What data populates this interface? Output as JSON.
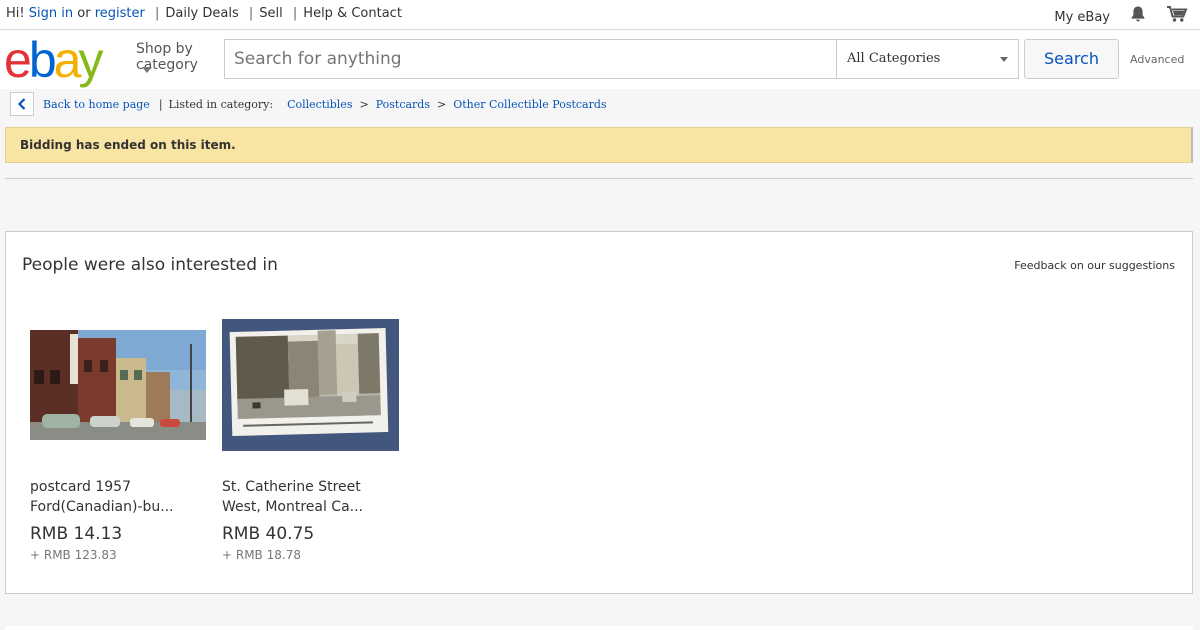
{
  "topbar": {
    "greeting": "Hi!",
    "signin": "Sign in",
    "or": "or",
    "register": "register",
    "daily_deals": "Daily Deals",
    "sell": "Sell",
    "help": "Help & Contact",
    "my_ebay": "My eBay",
    "icons": [
      "bell-icon",
      "cart-icon"
    ]
  },
  "header": {
    "logo": {
      "e": "e",
      "b": "b",
      "a": "a",
      "y": "y"
    },
    "shop_by_line1": "Shop by",
    "shop_by_line2": "category",
    "search_placeholder": "Search for anything",
    "category_selected": "All Categories",
    "search_button": "Search",
    "advanced": "Advanced"
  },
  "breadcrumb": {
    "back": "Back to home page",
    "listed": "Listed in category:",
    "items": [
      "Collectibles",
      "Postcards",
      "Other Collectible Postcards"
    ],
    "separator": ">"
  },
  "banner": {
    "message": "Bidding has ended on this item."
  },
  "suggestions": {
    "title": "People were also interested in",
    "feedback": "Feedback on our suggestions",
    "items": [
      {
        "title_line1": "postcard 1957",
        "title_line2": "Ford(Canadian)-bu...",
        "price": "RMB 14.13",
        "shipping": "+ RMB 123.83"
      },
      {
        "title_line1": "St. Catherine Street",
        "title_line2": "West, Montreal Ca...",
        "price": "RMB 40.75",
        "shipping": "+ RMB 18.78"
      }
    ]
  },
  "colors": {
    "link": "#0654ba",
    "banner_bg": "#f9e5a3",
    "logo_e": "#e53238",
    "logo_b": "#0064d2",
    "logo_a": "#f5af02",
    "logo_y": "#86b817"
  }
}
